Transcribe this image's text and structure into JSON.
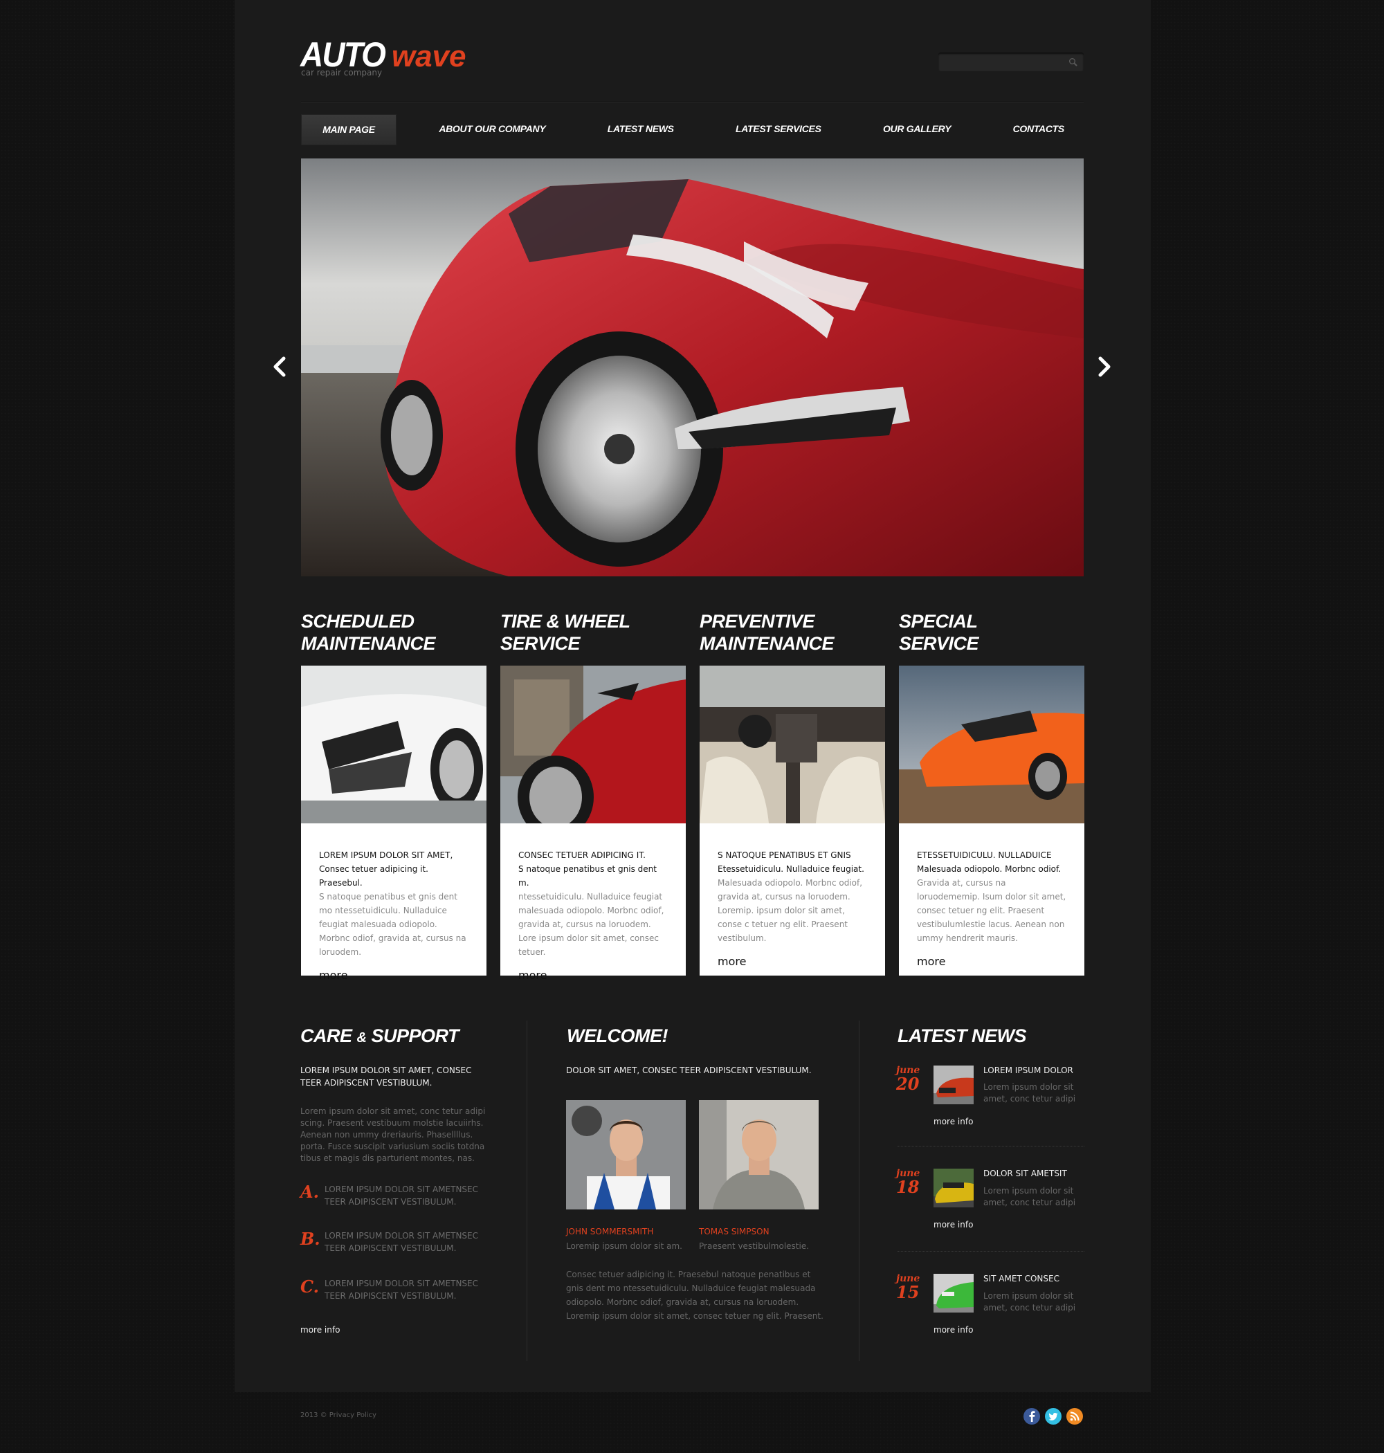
{
  "header": {
    "logo_main": "AUTO",
    "logo_accent": "wave",
    "tagline": "car repair company",
    "search": {
      "value": "",
      "placeholder": "",
      "icon": "search-icon"
    }
  },
  "nav": {
    "items": [
      {
        "label": "MAIN PAGE",
        "active": true
      },
      {
        "label": "ABOUT OUR COMPANY",
        "active": false
      },
      {
        "label": "LATEST NEWS",
        "active": false
      },
      {
        "label": "LATEST SERVICES",
        "active": false
      },
      {
        "label": "OUR GALLERY",
        "active": false
      },
      {
        "label": "CONTACTS",
        "active": false
      }
    ]
  },
  "slider": {
    "prev_icon": "chevron-left-icon",
    "next_icon": "chevron-right-icon",
    "image": "red sports car on wet beach"
  },
  "services": [
    {
      "title_line1": "SCHEDULED",
      "title_line2": "MAINTENANCE",
      "image": "white sports car headlight",
      "heading": "LOREM IPSUM DOLOR SIT AMET,",
      "subheading": "Consec tetuer adipicing it. Praesebul.",
      "text": "S natoque penatibus et gnis dent mo ntessetuidiculu. Nulladuice feugiat malesuada odiopolo. Morbnc odiof, gravida at, cursus na loruodem.",
      "more": "more"
    },
    {
      "title_line1": "TIRE & WHEEL",
      "title_line2": "SERVICE",
      "image": "red car wheel in city",
      "heading": "CONSEC TETUER ADIPICING IT.",
      "subheading": "S natoque penatibus et gnis dent m.",
      "text": "ntessetuidiculu. Nulladuice feugiat malesuada odiopolo. Morbnc odiof, gravida at, cursus na loruodem. Lore ipsum dolor sit amet, consec tetuer.",
      "more": "more"
    },
    {
      "title_line1": "PREVENTIVE",
      "title_line2": "MAINTENANCE",
      "image": "car interior with white seats",
      "heading": "S NATOQUE PENATIBUS ET GNIS",
      "subheading": "Etessetuidiculu. Nulladuice feugiat.",
      "text": "Malesuada odiopolo. Morbnc odiof, gravida at, cursus na loruodem. Loremip. ipsum dolor sit amet, conse c tetuer ng elit. Praesent vestibulum.",
      "more": "more"
    },
    {
      "title_line1": "SPECIAL",
      "title_line2": "SERVICE",
      "image": "orange sports car",
      "heading": "ETESSETUIDICULU. NULLADUICE",
      "subheading": "Malesuada odiopolo. Morbnc odiof.",
      "text": "Gravida at, cursus na loruodememip. Isum dolor sit amet, consec tetuer ng elit. Praesent vestibulumlestie lacus. Aenean non ummy hendrerit mauris.",
      "more": "more"
    }
  ],
  "care": {
    "title_a": "CARE",
    "title_amp": "&",
    "title_b": "SUPPORT",
    "intro": "LOREM IPSUM DOLOR SIT AMET, CONSEC TEER ADIPISCENT VESTIBULUM.",
    "text": "Lorem ipsum dolor sit amet, conc tetur adipi scing. Praesent vestibuum molstie lacuiirhs. Aenean non ummy dreriauris. Phasellllus. porta. Fusce suscipit variusium sociis totdna tibus et magis dis parturient montes, nas.",
    "list": [
      {
        "letter": "A.",
        "text": "LOREM IPSUM DOLOR SIT AMETNSEC TEER ADIPISCENT VESTIBULUM."
      },
      {
        "letter": "B.",
        "text": "LOREM IPSUM DOLOR SIT AMETNSEC TEER ADIPISCENT VESTIBULUM."
      },
      {
        "letter": "C.",
        "text": "LOREM IPSUM DOLOR SIT AMETNSEC TEER ADIPISCENT VESTIBULUM."
      }
    ],
    "more": "more info"
  },
  "welcome": {
    "title": "WELCOME!",
    "intro": "DOLOR SIT AMET, CONSEC TEER ADIPISCENT VESTIBULUM.",
    "people": [
      {
        "name": "JOHN SOMMERSMITH",
        "text": "Loremip ipsum dolor sit am.",
        "image": "mechanic in blue overalls"
      },
      {
        "name": "TOMAS SIMPSON",
        "text": "Praesent vestibulmolestie.",
        "image": "smiling mechanic in grey uniform"
      }
    ],
    "text": "Consec tetuer adipicing it. Praesebul natoque penatibus et gnis dent mo ntessetuidiculu. Nulladuice feugiat  malesuada odiopolo. Morbnc odiof,  gravida at, cursus na loruodem. Loremip ipsum dolor sit amet, consec tetuer ng elit. Praesent."
  },
  "news": {
    "title": "LATEST NEWS",
    "items": [
      {
        "month": "june",
        "day": "20",
        "title": "LOREM IPSUM DOLOR",
        "text": "Lorem ipsum dolor sit amet, conc tetur adipi",
        "more": "more info",
        "thumb": "red sports car",
        "color": "#c8391c"
      },
      {
        "month": "june",
        "day": "18",
        "title": "DOLOR SIT AMETSIT",
        "text": "Lorem ipsum dolor sit amet, conc tetur adipi",
        "more": "more info",
        "thumb": "yellow supercar",
        "color": "#d8b512"
      },
      {
        "month": "june",
        "day": "15",
        "title": "SIT AMET CONSEC",
        "text": "Lorem ipsum dolor sit amet, conc tetur adipi",
        "more": "more info",
        "thumb": "green hatchback",
        "color": "#3cb83a"
      }
    ]
  },
  "footer": {
    "copyright": "2013 © Privacy Policy",
    "social": [
      {
        "name": "facebook",
        "color": "#3b5a9a"
      },
      {
        "name": "twitter",
        "color": "#33bfe3"
      },
      {
        "name": "rss",
        "color": "#f08a23"
      }
    ]
  },
  "colors": {
    "accent": "#e0411f",
    "panel": "#1b1b1b",
    "background": "#121212"
  }
}
